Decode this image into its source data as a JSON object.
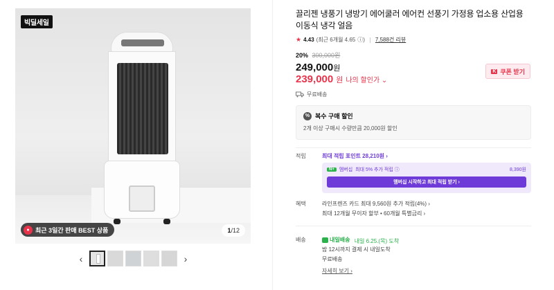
{
  "gallery": {
    "deal_badge": "빅딜세일",
    "promo_text": "최근 3일간 판매 BEST 상품",
    "counter_current": "1",
    "counter_total": "/12",
    "prev_label": "‹",
    "next_label": "›",
    "thumbnail_count": 5
  },
  "product": {
    "title": "끌리젠 냉풍기 냉방기 에어쿨러 에어컨 선풍기 가정용 업소용 산업용 이동식 냉각 얼음",
    "rating": "4.43",
    "rating_recent": "(최근 6개월 4.65",
    "rating_info": "ⓘ)",
    "review_count": "7,588건 리뷰",
    "discount_rate": "20%",
    "original_price": "300,000원",
    "price": "249,000",
    "price_unit": "원",
    "my_price": "239,000",
    "my_price_unit": "원",
    "my_price_label": "나의 할인가 ⌄",
    "coupon_label": "쿠폰 받기",
    "coupon_icon": "K",
    "shipping": "무료배송"
  },
  "multi_purchase": {
    "title": "복수 구매 할인",
    "icon": "%",
    "description": "2개 이상 구매시 수량만큼 20,000원 할인"
  },
  "points": {
    "label": "적립",
    "max_points": "최대 적립 포인트 28,210원 ›",
    "membership_tag": "N+",
    "membership_text": "멤버십",
    "membership_extra": "최대 5% 추가 적립 ⓘ",
    "membership_amount": "8,390원",
    "membership_button": "멤버십 시작하고 최대 적립 받기 ›"
  },
  "benefits": {
    "label": "혜택",
    "line1": "라인프렌즈 카드 최대 9,560원 추가 적립(4%) ›",
    "line2": "최대 12개월 무이자 할부 • 60개월 특별금리 ›"
  },
  "delivery": {
    "label": "배송",
    "tag": "내일배송",
    "date": "내일 6.25.(목) 도착",
    "note": "밤 12시까지 결제 시 내일도착",
    "fee": "무료배송",
    "detail_link": "자세히 보기 ›"
  },
  "colors": {
    "accent_red": "#e8334a",
    "accent_purple": "#6e3bd8",
    "accent_green": "#2bb24c"
  }
}
